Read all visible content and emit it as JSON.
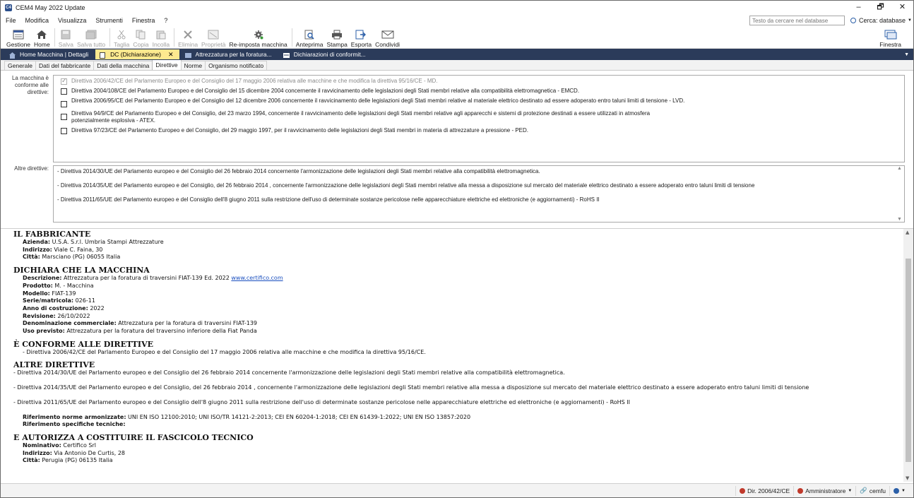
{
  "window": {
    "title": "CEM4 May 2022 Update",
    "minimize": "–",
    "maximize": "🗗",
    "close": "✕"
  },
  "menu": [
    "File",
    "Modifica",
    "Visualizza",
    "Strumenti",
    "Finestra",
    "?"
  ],
  "search": {
    "placeholder": "Testo da cercare nel database",
    "scope_label": "Cerca: database"
  },
  "toolbar": {
    "gestione": "Gestione",
    "home": "Home",
    "salva": "Salva",
    "salva_tutto": "Salva tutto",
    "taglia": "Taglia",
    "copia": "Copia",
    "incolla": "Incolla",
    "elimina": "Elimina",
    "proprieta": "Proprietà",
    "reimposta": "Re-imposta macchina",
    "anteprima": "Anteprima",
    "stampa": "Stampa",
    "esporta": "Esporta",
    "condividi": "Condividi",
    "finestra": "Finestra"
  },
  "doc_tabs": [
    "Home Macchina | Dettagli",
    "DC (Dichiarazione)",
    "Attrezzatura per la foratura...",
    "Dichiarazioni di conformit..."
  ],
  "sub_tabs": [
    "Generale",
    "Dati del fabbricante",
    "Dati della macchina",
    "Direttive",
    "Norme",
    "Organismo notificato"
  ],
  "form": {
    "conforme_label_1": "La macchina è",
    "conforme_label_2": "conforme alle",
    "conforme_label_3": "direttive:",
    "directives": [
      {
        "text": "Direttiva 2006/42/CE del Parlamento Europeo e del Consiglio del 17 maggio 2006 relativa alle macchine e che modifica la direttiva 95/16/CE - MD.",
        "checked": true,
        "disabled": true
      },
      {
        "text": "Direttiva 2004/108/CE del Parlamento Europeo e del Consiglio del 15 dicembre 2004 concernente il ravvicinamento delle legislazioni degli Stati membri relative alla compatibilità elettromagnetica - EMCD.",
        "checked": false,
        "disabled": false
      },
      {
        "text": "Direttiva 2006/95/CE del Parlamento Europeo e del Consiglio del 12 dicembre 2006 concernente il ravvicinamento delle legislazioni degli Stati membri relative al materiale elettrico destinato ad essere adoperato entro taluni limiti di tensione - LVD.",
        "checked": false,
        "disabled": false
      },
      {
        "text": "Direttiva 94/9/CE del Parlamento Europeo e del Consiglio, del 23 marzo 1994, concernente il ravvicinamento delle legislazioni degli Stati membri relative agli apparecchi e sistemi di protezione destinati a essere utilizzati in atmosfera potenzialmente esplosiva - ATEX.",
        "checked": false,
        "disabled": false
      },
      {
        "text": "Direttiva 97/23/CE del Parlamento Europeo e del Consiglio, del 29 maggio 1997, per il ravvicinamento delle legislazioni degli Stati membri in materia di attrezzature a pressione - PED.",
        "checked": false,
        "disabled": false
      }
    ],
    "altre_label": "Altre direttive:",
    "altre": [
      "- Direttiva 2014/30/UE del Parlamento europeo e del Consiglio del 26 febbraio 2014 concernente l'armonizzazione delle legislazioni degli Stati membri relative alla compatibilità elettromagnetica.",
      "- Direttiva 2014/35/UE del Parlamento europeo e del Consiglio, del 26 febbraio 2014 , concernente l'armonizzazione delle legislazioni degli Stati membri relative alla messa a disposizione sul mercato del materiale elettrico destinato a essere adoperato entro taluni limiti di tensione",
      "- Direttiva 2011/65/UE del Parlamento europeo e del Consiglio dell'8 giugno 2011 sulla restrizione dell'uso di determinate sostanze pericolose nelle apparecchiature elettriche ed elettroniche (e aggiornamenti) - RoHS II"
    ]
  },
  "preview": {
    "h_fabbricante": "IL FABBRICANTE",
    "azienda_k": "Azienda:",
    "azienda_v": " U.S.A. S.r.l. Umbria Stampi Attrezzature",
    "indirizzo_k": "Indirizzo:",
    "indirizzo_v": " Viale C. Faina, 30",
    "citta_k": "Città:",
    "citta_v": " Marsciano (PG) 06055 Italia",
    "h_dichiara": "DICHIARA CHE LA MACCHINA",
    "descrizione_k": "Descrizione:",
    "descrizione_v": " Attrezzatura per la foratura di traversini FIAT-139 Ed. 2022 ",
    "descrizione_link": "www.certifico.com",
    "prodotto_k": "Prodotto:",
    "prodotto_v": " M. - Macchina",
    "modello_k": "Modello:",
    "modello_v": " FIAT-139",
    "serie_k": "Serie/matricola:",
    "serie_v": " 026-11",
    "anno_k": "Anno di costruzione:",
    "anno_v": " 2022",
    "revisione_k": "Revisione:",
    "revisione_v": " 26/10/2022",
    "denominazione_k": "Denominazione commerciale:",
    "denominazione_v": " Attrezzatura per la foratura di traversini FIAT-139",
    "uso_k": "Uso previsto:",
    "uso_v": " Attrezzatura per la foratura del traversino inferiore della Fiat Panda",
    "h_conforme": "È CONFORME ALLE DIRETTIVE",
    "conforme_line": "- Direttiva 2006/42/CE del Parlamento Europeo e del Consiglio del 17 maggio 2006 relativa alle macchine e che modifica la direttiva 95/16/CE.",
    "h_altre": "ALTRE DIRETTIVE",
    "altre_1": "- Direttiva 2014/30/UE del Parlamento europeo e del Consiglio del 26 febbraio 2014 concernente l'armonizzazione delle legislazioni degli Stati membri relative alla compatibilità elettromagnetica.",
    "altre_2": "- Direttiva 2014/35/UE del Parlamento europeo e del Consiglio, del 26 febbraio 2014 , concernente l'armonizzazione delle legislazioni degli Stati membri relative alla messa a disposizione sul mercato del materiale elettrico destinato a essere adoperato entro taluni limiti di tensione",
    "altre_3": "- Direttiva 2011/65/UE del Parlamento europeo e del Consiglio dell'8 giugno 2011 sulla restrizione dell'uso di determinate sostanze pericolose nelle apparecchiature elettriche ed elettroniche (e aggiornamenti) - RoHS II",
    "norme_k": "Riferimento norme armonizzate:",
    "norme_v": " UNI EN ISO 12100:2010; UNI ISO/TR 14121-2:2013; CEI EN 60204-1:2018; CEI EN 61439-1:2022; UNI EN ISO 13857:2020",
    "specifiche_k": "Riferimento specifiche tecniche:",
    "h_autorizza": "E AUTORIZZA A COSTITUIRE IL FASCICOLO TECNICO",
    "nominativo_k": "Nominativo:",
    "nominativo_v": " Certifico Srl",
    "indirizzo2_k": "Indirizzo:",
    "indirizzo2_v": " Via Antonio De Curtis, 28",
    "citta2_k": "Città:",
    "citta2_v": " Perugia (PG) 06135 Italia"
  },
  "status": {
    "directive": "Dir. 2006/42/CE",
    "user": "Amministratore",
    "db": "cemfu"
  },
  "colors": {
    "doc_tab_bar": "#2b3b5a",
    "active_doc_tab": "#fde98f",
    "link": "#1a4fbf"
  }
}
